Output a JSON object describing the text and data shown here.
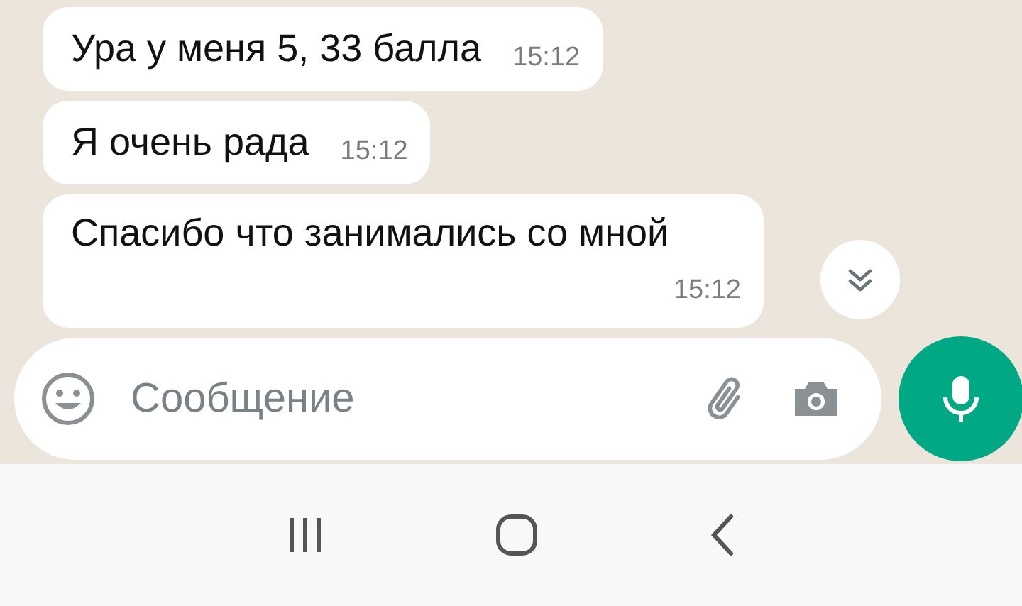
{
  "messages": [
    {
      "kind": "inline",
      "text": "Ура у меня 5, 33 балла",
      "time": "15:12"
    },
    {
      "kind": "inline",
      "text": "Я очень рада",
      "time": "15:12"
    },
    {
      "kind": "stacked",
      "text": "Спасибо что занимались со мной",
      "time": "15:12"
    }
  ],
  "composer": {
    "placeholder": "Сообщение"
  }
}
